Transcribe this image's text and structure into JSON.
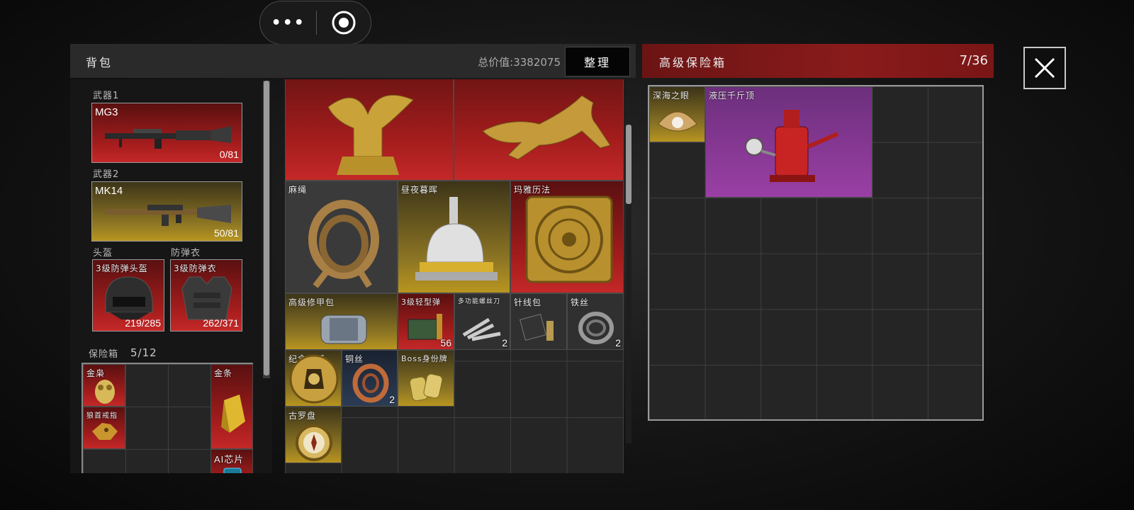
{
  "top_capsule": {
    "more_icon": "more-dots-icon",
    "record_icon": "record-target-icon"
  },
  "bag": {
    "title": "背包",
    "total_value_label": "总价值:",
    "total_value": "3382075",
    "sort_button": "整理"
  },
  "equipment": {
    "weapon1": {
      "slot": "武器1",
      "name": "MG3",
      "ammo": "0/81"
    },
    "weapon2": {
      "slot": "武器2",
      "name": "MK14",
      "ammo": "50/81"
    },
    "helmet": {
      "slot": "头盔",
      "name": "3级防弹头盔",
      "durability": "219/285"
    },
    "armor": {
      "slot": "防弹衣",
      "name": "3级防弹衣",
      "durability": "262/371"
    },
    "safebox": {
      "label": "保险箱",
      "count": "5/12",
      "items": [
        {
          "name": "金枭",
          "rarity": "red"
        },
        {
          "name": "金条",
          "rarity": "red"
        },
        {
          "name": "狼首戒指",
          "rarity": "red"
        },
        {
          "name": "AI芯片",
          "rarity": "red"
        }
      ]
    }
  },
  "bag_items": [
    {
      "name": "",
      "rarity": "red",
      "icon": "golden-eagle-statue-icon"
    },
    {
      "name": "",
      "rarity": "red",
      "icon": "golden-horse-statue-icon"
    },
    {
      "name": "麻绳",
      "rarity": "dark",
      "icon": "rope-icon"
    },
    {
      "name": "昼夜暮晖",
      "rarity": "gold",
      "icon": "desk-lamp-icon"
    },
    {
      "name": "玛雅历法",
      "rarity": "red",
      "icon": "maya-calendar-icon"
    },
    {
      "name": "高级修甲包",
      "rarity": "gold",
      "icon": "armor-repair-kit-icon"
    },
    {
      "name": "3级轻型弹",
      "rarity": "red",
      "count": "56",
      "icon": "ammo-box-icon"
    },
    {
      "name": "多功能螺丝刀",
      "rarity": "dark",
      "count": "2",
      "icon": "multitool-icon"
    },
    {
      "name": "针线包",
      "rarity": "dark",
      "icon": "sewing-kit-icon"
    },
    {
      "name": "铁丝",
      "rarity": "dark",
      "count": "2",
      "icon": "wire-coil-icon"
    },
    {
      "name": "纪念金币",
      "rarity": "gold",
      "icon": "pharaoh-coin-icon"
    },
    {
      "name": "铜丝",
      "rarity": "blue",
      "count": "2",
      "icon": "copper-wire-icon"
    },
    {
      "name": "Boss身份牌",
      "rarity": "gold",
      "icon": "dog-tags-icon"
    },
    {
      "name": "古罗盘",
      "rarity": "gold",
      "icon": "compass-icon"
    }
  ],
  "advanced_safe": {
    "title": "高级保险箱",
    "count": "7/36",
    "items": [
      {
        "name": "深海之眼",
        "rarity": "gold",
        "icon": "pearl-shell-icon"
      },
      {
        "name": "液压千斤顶",
        "rarity": "purple",
        "icon": "hydraulic-jack-icon"
      }
    ]
  },
  "colors": {
    "red": "#b72222",
    "gold": "#a88a20",
    "purple": "#8e3a9c",
    "panel": "#2a2a2a"
  }
}
